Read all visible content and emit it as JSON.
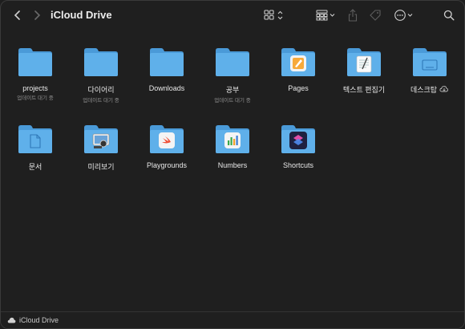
{
  "window": {
    "title": "iCloud Drive"
  },
  "items": [
    {
      "label": "projects",
      "sub": "업데이트 대기 중",
      "kind": "plain"
    },
    {
      "label": "다이어리",
      "sub": "업데이트 대기 중",
      "kind": "plain"
    },
    {
      "label": "Downloads",
      "sub": "",
      "kind": "plain"
    },
    {
      "label": "공부",
      "sub": "업데이트 대기 중",
      "kind": "plain"
    },
    {
      "label": "Pages",
      "sub": "",
      "kind": "pages"
    },
    {
      "label": "텍스트 편집기",
      "sub": "",
      "kind": "textedit"
    },
    {
      "label": "데스크탑",
      "sub": "",
      "kind": "desktop",
      "cloud": true
    },
    {
      "label": "문서",
      "sub": "",
      "kind": "docs"
    },
    {
      "label": "미리보기",
      "sub": "",
      "kind": "preview"
    },
    {
      "label": "Playgrounds",
      "sub": "",
      "kind": "swift"
    },
    {
      "label": "Numbers",
      "sub": "",
      "kind": "numbers"
    },
    {
      "label": "Shortcuts",
      "sub": "",
      "kind": "shortcuts"
    }
  ],
  "statusbar": {
    "label": "iCloud Drive"
  },
  "colors": {
    "folder": "#5fb0ea",
    "folder_dark": "#4a9ad8",
    "bg": "#1f1f1f"
  }
}
